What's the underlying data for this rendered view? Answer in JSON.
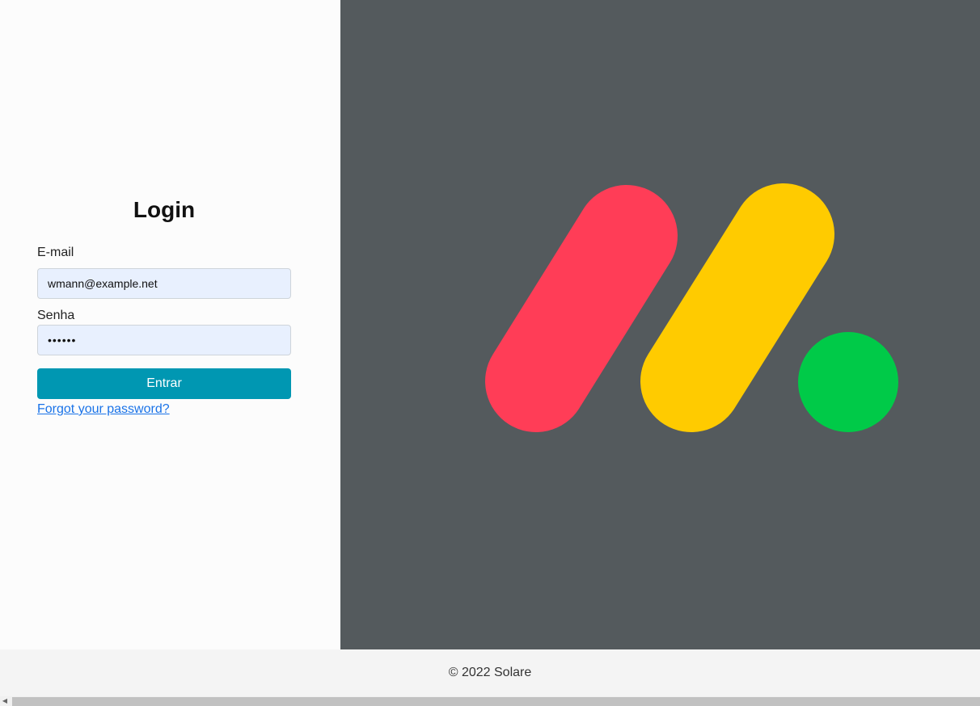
{
  "login": {
    "title": "Login",
    "email_label": "E-mail",
    "email_value": "wmann@example.net",
    "password_label": "Senha",
    "password_value": "••••••",
    "submit_label": "Entrar",
    "forgot_label": "Forgot your password?"
  },
  "footer": {
    "text": "© 2022 Solare"
  },
  "colors": {
    "panel_background": "#545a5d",
    "button": "#0097b2",
    "logo_red": "#ff3d57",
    "logo_yellow": "#ffcb00",
    "logo_green": "#00ca48"
  },
  "icons": {
    "logo": "monday-style-logo",
    "scroll_left": "scroll-left-arrow-icon"
  }
}
